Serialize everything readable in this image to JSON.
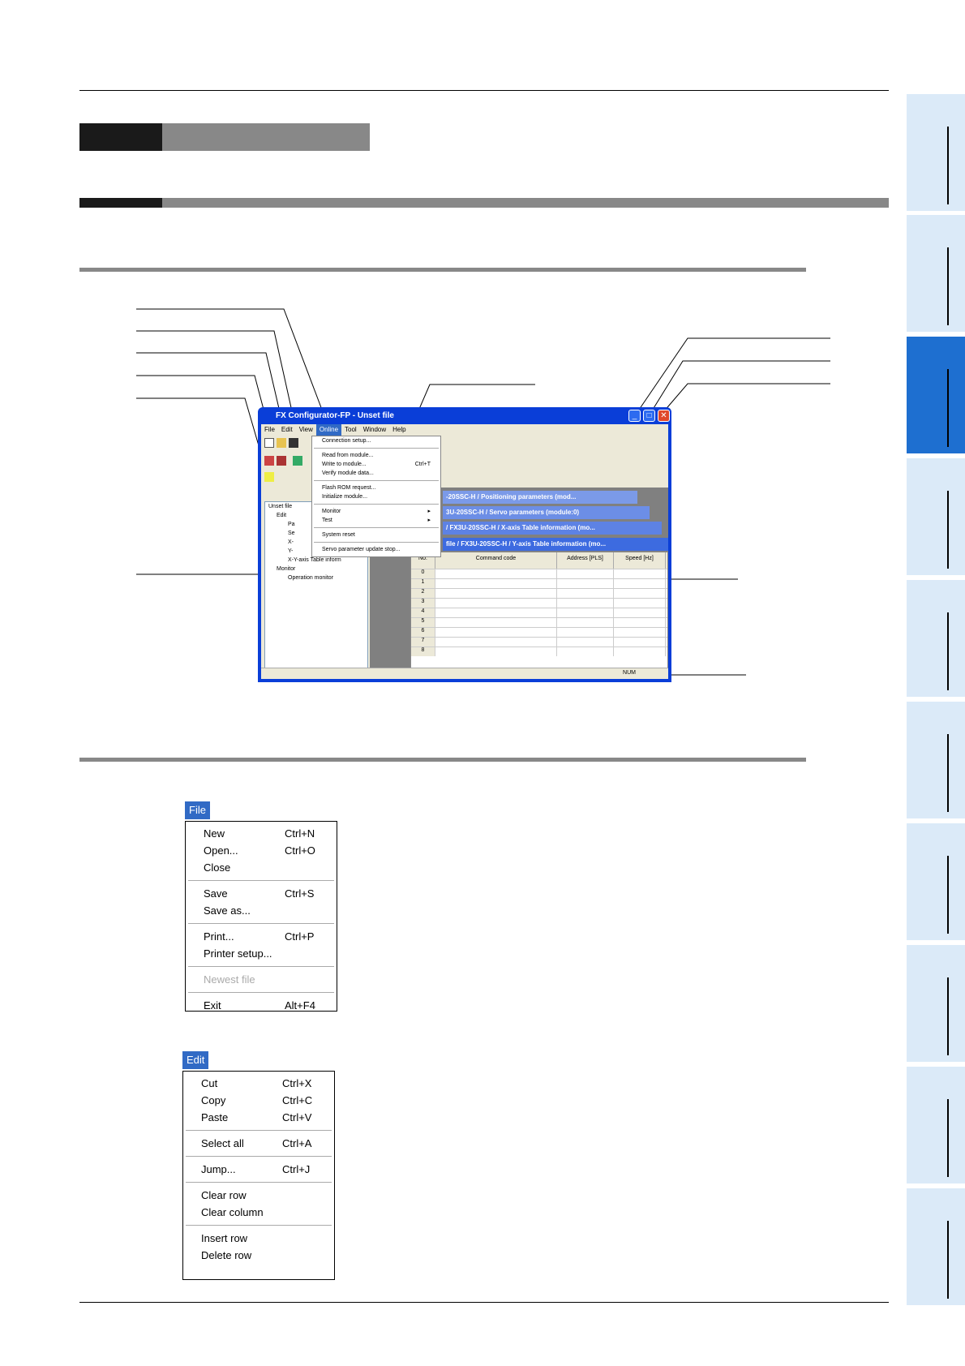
{
  "window": {
    "title": "FX Configurator-FP - Unset file",
    "menubar": [
      "File",
      "Edit",
      "View",
      "Online",
      "Tool",
      "Window",
      "Help"
    ],
    "online_menu": [
      {
        "label": "Connection setup...",
        "shortcut": ""
      },
      {
        "sep": true
      },
      {
        "label": "Read from module...",
        "shortcut": ""
      },
      {
        "label": "Write to module...",
        "shortcut": "Ctrl+T"
      },
      {
        "label": "Verify module data...",
        "shortcut": ""
      },
      {
        "sep": true
      },
      {
        "label": "Flash ROM request...",
        "shortcut": ""
      },
      {
        "label": "Initialize module...",
        "shortcut": ""
      },
      {
        "sep": true
      },
      {
        "label": "Monitor",
        "shortcut": "▸"
      },
      {
        "label": "Test",
        "shortcut": "▸"
      },
      {
        "sep": true
      },
      {
        "label": "System reset",
        "shortcut": ""
      },
      {
        "sep": true
      },
      {
        "label": "Servo parameter update stop...",
        "shortcut": ""
      }
    ],
    "tree": [
      "Unset file",
      "Edit",
      "Pa",
      "Se",
      "X-",
      "Y-",
      "X-Y-axis Table inform",
      "Monitor",
      "Operation monitor"
    ],
    "child_windows": [
      "-20SSC-H / Positioning parameters (mod...",
      "3U-20SSC-H / Servo parameters (module:0)",
      "/ FX3U-20SSC-H / X-axis Table information (mo...",
      "file / FX3U-20SSC-H / Y-axis Table information (mo..."
    ],
    "grid": {
      "headers": [
        "No.",
        "Command code",
        "Address [PLS]",
        "Speed [Hz]"
      ],
      "rows": [
        "0",
        "1",
        "2",
        "3",
        "4",
        "5",
        "6",
        "7",
        "8"
      ]
    },
    "status": "NUM"
  },
  "file_menu": {
    "title": "File",
    "items": [
      {
        "label": "New",
        "shortcut": "Ctrl+N"
      },
      {
        "label": "Open...",
        "shortcut": "Ctrl+O"
      },
      {
        "label": "Close",
        "shortcut": ""
      },
      {
        "sep": true
      },
      {
        "label": "Save",
        "shortcut": "Ctrl+S"
      },
      {
        "label": "Save as...",
        "shortcut": ""
      },
      {
        "sep": true
      },
      {
        "label": "Print...",
        "shortcut": "Ctrl+P"
      },
      {
        "label": "Printer setup...",
        "shortcut": ""
      },
      {
        "sep": true
      },
      {
        "label": "Newest file",
        "shortcut": "",
        "disabled": true
      },
      {
        "sep": true
      },
      {
        "label": "Exit",
        "shortcut": "Alt+F4"
      }
    ]
  },
  "edit_menu": {
    "title": "Edit",
    "items": [
      {
        "label": "Cut",
        "shortcut": "Ctrl+X"
      },
      {
        "label": "Copy",
        "shortcut": "Ctrl+C"
      },
      {
        "label": "Paste",
        "shortcut": "Ctrl+V"
      },
      {
        "sep": true
      },
      {
        "label": "Select all",
        "shortcut": "Ctrl+A"
      },
      {
        "sep": true
      },
      {
        "label": "Jump...",
        "shortcut": "Ctrl+J"
      },
      {
        "sep": true
      },
      {
        "label": "Clear row",
        "shortcut": ""
      },
      {
        "label": "Clear column",
        "shortcut": ""
      },
      {
        "sep": true
      },
      {
        "label": "Insert row",
        "shortcut": ""
      },
      {
        "label": "Delete row",
        "shortcut": ""
      }
    ]
  }
}
